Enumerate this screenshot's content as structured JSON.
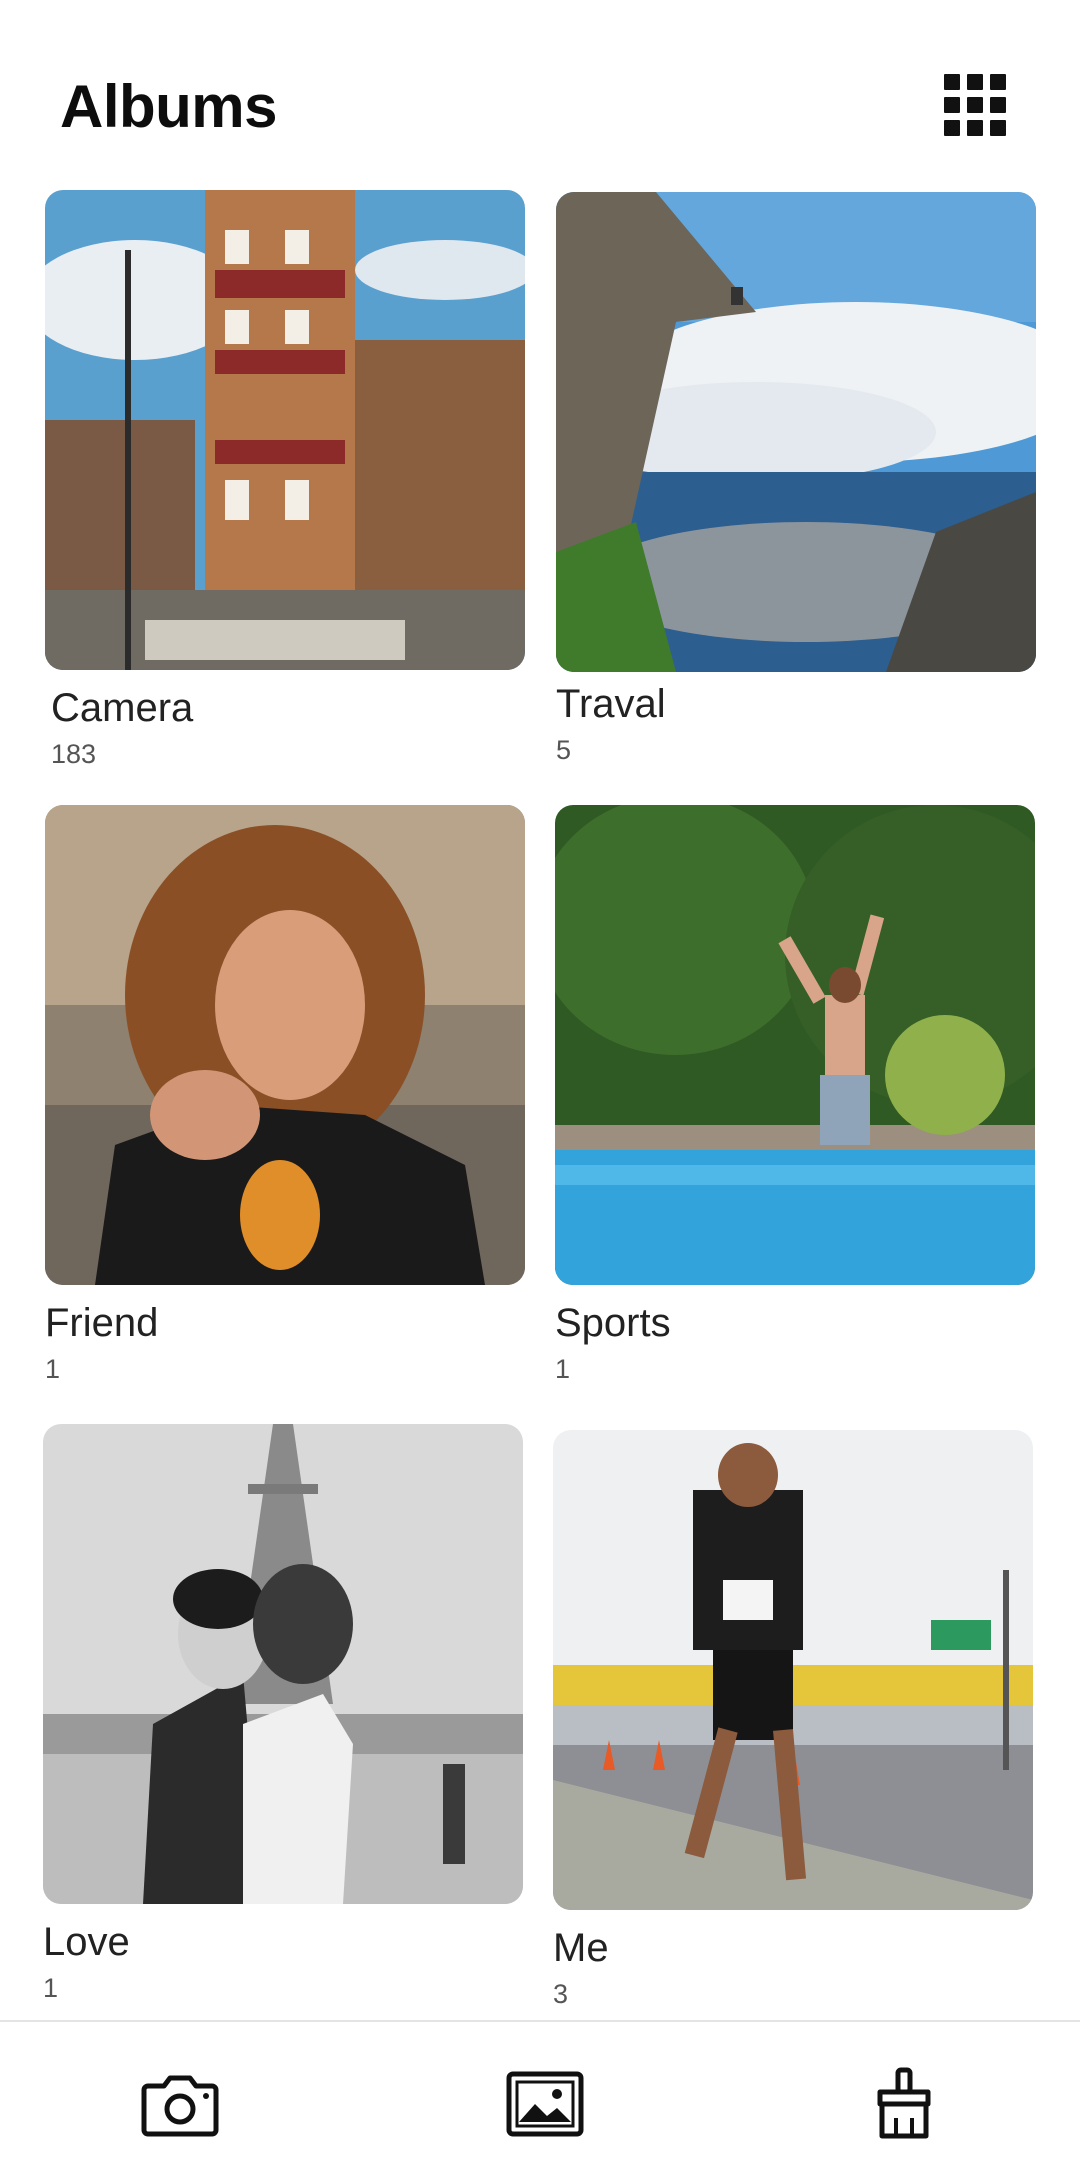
{
  "header": {
    "title": "Albums",
    "view_toggle_icon": "grid-view-icon"
  },
  "albums": [
    {
      "name": "Camera",
      "count": "183",
      "photo": "city-street-buildings"
    },
    {
      "name": "Traval",
      "count": "5",
      "photo": "cliff-above-clouds"
    },
    {
      "name": "Friend",
      "count": "1",
      "photo": "woman-pointing-portrait"
    },
    {
      "name": "Sports",
      "count": "1",
      "photo": "man-jumping-into-pool"
    },
    {
      "name": "Love",
      "count": "1",
      "photo": "couple-eiffel-tower-bw"
    },
    {
      "name": "Me",
      "count": "3",
      "photo": "man-running-race"
    }
  ],
  "bottom_nav": {
    "items": [
      {
        "icon": "camera-icon"
      },
      {
        "icon": "image-icon"
      },
      {
        "icon": "brush-icon"
      }
    ]
  },
  "colors": {
    "background": "#ffffff",
    "text_primary": "#222222",
    "text_secondary": "#555555",
    "divider": "#e4e4e4"
  }
}
